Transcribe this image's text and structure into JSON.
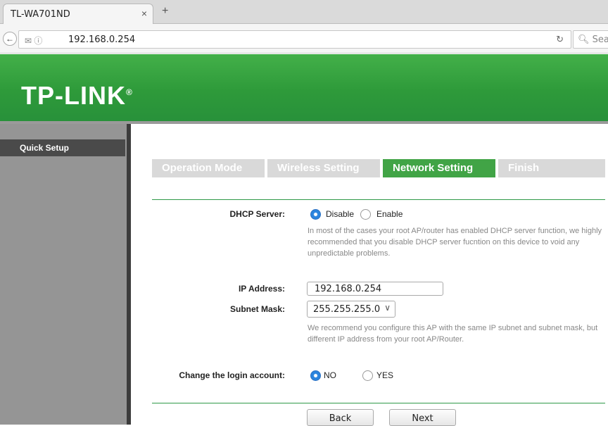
{
  "browser": {
    "tab_title": "TL-WA701ND",
    "tab_close": "×",
    "new_tab": "+",
    "url": "192.168.0.254",
    "search_placeholder": "Sea",
    "reload_icon": "↻"
  },
  "header": {
    "logo": "TP-LINK",
    "logo_mark": "®"
  },
  "sidebar": {
    "items": [
      {
        "label": "Quick Setup"
      }
    ]
  },
  "steps": [
    {
      "label": "Operation Mode",
      "active": false
    },
    {
      "label": "Wireless Setting",
      "active": false
    },
    {
      "label": "Network Setting",
      "active": true
    },
    {
      "label": "Finish",
      "active": false
    }
  ],
  "form": {
    "dhcp": {
      "label": "DHCP Server:",
      "options": [
        "Disable",
        "Enable"
      ],
      "selected": "Disable",
      "note": "In most of the cases your root AP/router has enabled DHCP server function, we highly recommended that you disable DHCP server fucntion on this device to void any unpredictable problems."
    },
    "ip": {
      "label": "IP Address:",
      "value": "192.168.0.254"
    },
    "mask": {
      "label": "Subnet Mask:",
      "value": "255.255.255.0",
      "note": "We recommend you configure this AP with the same IP subnet and subnet mask, but different IP address from your root AP/Router."
    },
    "login": {
      "label": "Change the login account:",
      "options": [
        "NO",
        "YES"
      ],
      "selected": "NO"
    }
  },
  "buttons": {
    "back": "Back",
    "next": "Next"
  },
  "colors": {
    "brand_green": "#41a446",
    "step_inactive": "#d9d9d9",
    "sidebar": "#959595",
    "radio_selected": "#2a84de"
  }
}
